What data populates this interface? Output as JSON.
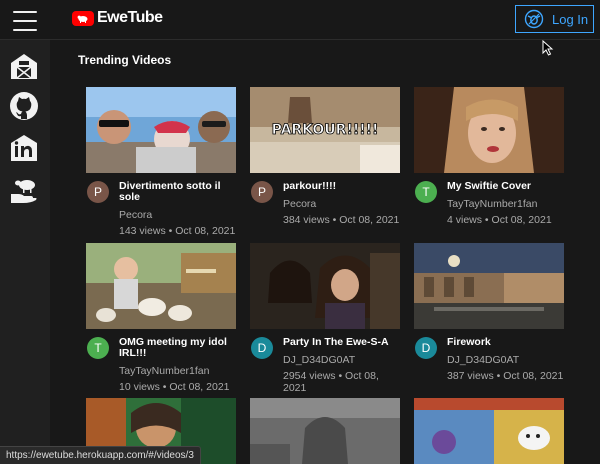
{
  "app": {
    "brand": "EweTube",
    "login_label": "Log In",
    "accent": "#3ea6ff",
    "brand_color": "#ff0000"
  },
  "sidebar": {
    "items": [
      {
        "icon": "barn-icon"
      },
      {
        "icon": "github-icon"
      },
      {
        "icon": "linkedin-icon"
      },
      {
        "icon": "sheep-in-hand-icon"
      }
    ]
  },
  "main": {
    "section_title": "Trending Videos",
    "videos": [
      {
        "title": "Divertimento sotto il sole",
        "channel": "Pecora",
        "views": "143 views",
        "date": "Oct 08, 2021",
        "avatar_letter": "P",
        "avatar_color": "#795548"
      },
      {
        "title": "parkour!!!!",
        "channel": "Pecora",
        "views": "384 views",
        "date": "Oct 08, 2021",
        "avatar_letter": "P",
        "avatar_color": "#795548",
        "thumb_text": "PARKOUR!!!!!"
      },
      {
        "title": "My Swiftie Cover",
        "channel": "TayTayNumber1fan",
        "views": "4 views",
        "date": "Oct 08, 2021",
        "avatar_letter": "T",
        "avatar_color": "#4caf50"
      },
      {
        "title": "OMG meeting my idol IRL!!!",
        "channel": "TayTayNumber1fan",
        "views": "10 views",
        "date": "Oct 08, 2021",
        "avatar_letter": "T",
        "avatar_color": "#4caf50"
      },
      {
        "title": "Party In The Ewe-S-A",
        "channel": "DJ_D34DG0AT",
        "views": "2954 views",
        "date": "Oct 08, 2021",
        "avatar_letter": "D",
        "avatar_color": "#1a8a9a"
      },
      {
        "title": "Firework",
        "channel": "DJ_D34DG0AT",
        "views": "387 views",
        "date": "Oct 08, 2021",
        "avatar_letter": "D",
        "avatar_color": "#1a8a9a"
      }
    ]
  },
  "status_url": "https://ewetube.herokuapp.com/#/videos/3"
}
